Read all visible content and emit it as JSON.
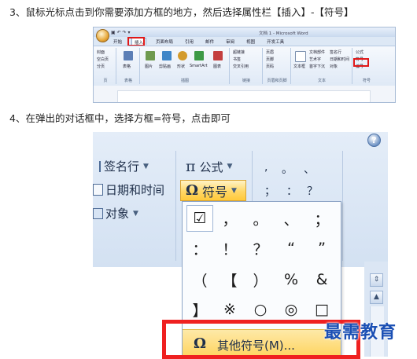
{
  "step3": {
    "text": "3、鼠标光标点击到你需要添加方框的地方，然后选择属性栏【插入】-【符号】"
  },
  "step4": {
    "text": "4、在弹出的对话框中，选择方框=符号，点击即可"
  },
  "ribbon_small": {
    "window_title": "文档 1 - Microsoft Word",
    "tabs": [
      "开始",
      "插入",
      "页面布局",
      "引用",
      "邮件",
      "审阅",
      "视图",
      "开发工具"
    ],
    "active_tab": "插入",
    "groups": [
      {
        "name": "页",
        "items": [
          "封面",
          "空白页",
          "分页"
        ]
      },
      {
        "name": "表格",
        "items": [
          "表格"
        ]
      },
      {
        "name": "插图",
        "items": [
          "图片",
          "剪贴画",
          "形状",
          "SmartArt",
          "图表"
        ]
      },
      {
        "name": "链接",
        "items": [
          "超链接",
          "书签",
          "交叉引用"
        ]
      },
      {
        "name": "页眉和页脚",
        "items": [
          "页眉",
          "页脚",
          "页码"
        ]
      },
      {
        "name": "文本",
        "items": [
          "文本框",
          "文档部件",
          "艺术字",
          "首字下沉",
          "签名行",
          "日期和时间",
          "对象"
        ]
      },
      {
        "name": "符号",
        "items": [
          "公式",
          "符号",
          "编号"
        ]
      }
    ]
  },
  "ribbon_large": {
    "items": {
      "signature": "签名行",
      "datetime": "日期和时间",
      "object": "对象",
      "formula": "公式",
      "symbol": "符号"
    },
    "help_icon": "?",
    "small_symbols": [
      ",",
      "。",
      "、",
      "；",
      "：",
      "？"
    ],
    "dropdown": {
      "symbols": [
        "☑",
        "，",
        "。",
        "、",
        "；",
        "：",
        "！",
        "？",
        "“",
        "”",
        "（",
        "【",
        "）",
        "%",
        "&",
        "】",
        "※",
        "○",
        "◎",
        "□"
      ],
      "more_label": "其他符号(M)..."
    }
  },
  "watermark": "最需教育",
  "colors": {
    "highlight_red": "#e01818",
    "selected_orange": "#ffd35c",
    "ribbon_blue": "#dbe6f4",
    "watermark_blue": "#1a4fb4"
  }
}
